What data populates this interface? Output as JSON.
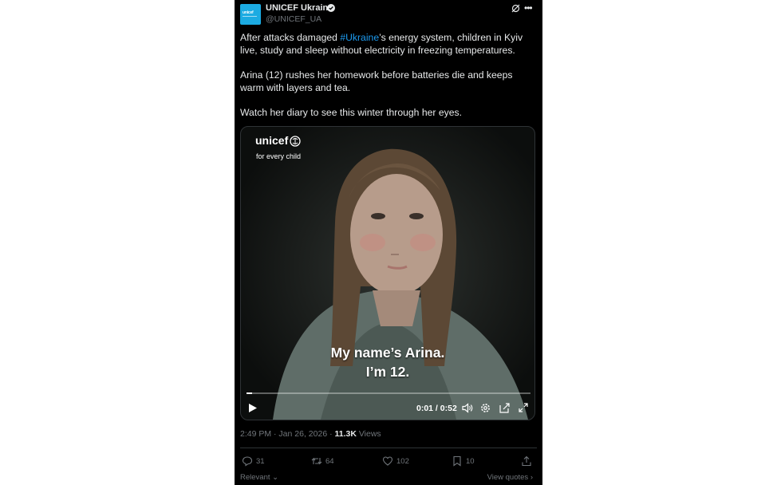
{
  "post": {
    "author_name": "UNICEF Ukraine",
    "author_handle": "@UNICEF_UA",
    "avatar_text": "unicef",
    "text": {
      "p1_before": "After attacks damaged ",
      "hashtag": "#Ukraine",
      "p1_after": "’s energy system, children in Kyiv live, study and sleep without electricity in freezing temperatures.",
      "p2": "Arina (12) rushes her homework before batteries die and keeps warm with layers and tea.",
      "p3": "Watch her diary to see this winter through her eyes."
    },
    "video": {
      "brand": "unicef",
      "tagline": "for every child",
      "subtitle_line1": "My name’s Arina.",
      "subtitle_line2": "I’m 12.",
      "time": "0:01 / 0:52",
      "progress_fraction": 0.02
    },
    "timestamp": "2:49 PM · Jan 26, 2026 · ",
    "views_count": "11.3K",
    "views_label": " Views",
    "actions": {
      "replies": "31",
      "reposts": "64",
      "likes": "102",
      "bookmarks": "10"
    },
    "sort_label": "Relevant",
    "view_quotes_label": "View quotes"
  },
  "colors": {
    "background": "#000000",
    "text": "#e7e9ea",
    "muted": "#71767b",
    "link": "#1d9bf0",
    "unicef_blue": "#1cabe2"
  }
}
